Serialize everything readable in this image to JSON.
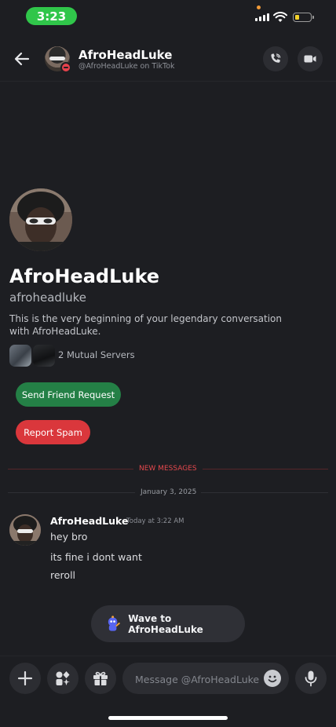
{
  "status_bar": {
    "time": "3:23"
  },
  "header": {
    "name": "AfroHeadLuke",
    "chevron": "›",
    "subtitle": "@AfroHeadLuke on TikTok",
    "icons": [
      "back-arrow-icon",
      "phone-icon",
      "video-camera-icon"
    ]
  },
  "profile": {
    "display_name": "AfroHeadLuke",
    "username": "afroheadluke",
    "intro": "This is the very beginning of your legendary conversation with AfroHeadLuke.",
    "mutual_servers": "2 Mutual Servers",
    "send_friend_request": "Send Friend Request",
    "report_spam": "Report Spam"
  },
  "dividers": {
    "new_messages": "NEW MESSAGES",
    "date": "January 3, 2025"
  },
  "message": {
    "author": "AfroHeadLuke",
    "timestamp": "Today at 3:22 AM",
    "lines": [
      "hey bro",
      "its fine i dont want",
      "reroll"
    ]
  },
  "wave": {
    "label": "Wave to AfroHeadLuke"
  },
  "composer": {
    "placeholder": "Message @AfroHeadLuke",
    "icons": [
      "plus-icon",
      "apps-icon",
      "gift-icon",
      "emoji-icon",
      "microphone-icon"
    ]
  },
  "colors": {
    "background": "#1d1e22",
    "status_time_pill": "#30c64a",
    "friend_button": "#248046",
    "spam_button": "#da373c",
    "new_messages": "#e5484d"
  }
}
